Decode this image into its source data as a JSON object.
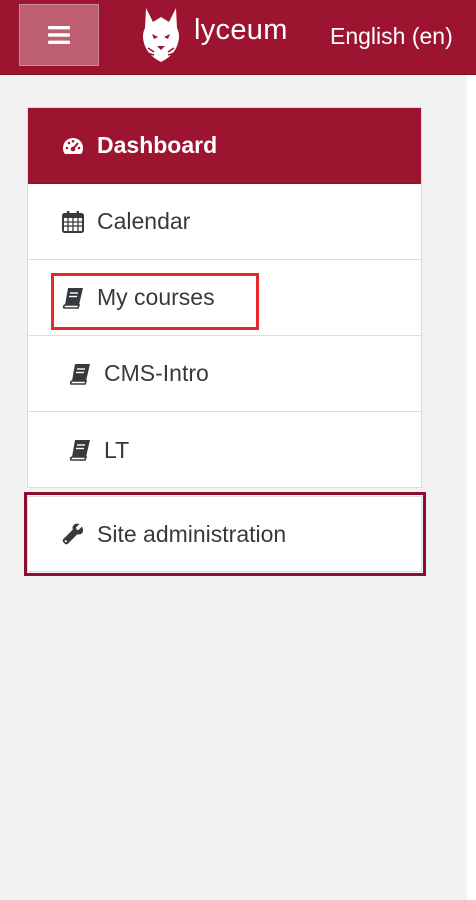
{
  "header": {
    "brand": "lyceum",
    "language": "English (en)",
    "colors": {
      "primary": "#9d1430",
      "menu_button": "#bd5f70"
    },
    "menu_icon": "hamburger-icon",
    "logo_icon": "lynx-logo-icon"
  },
  "nav": {
    "items": [
      {
        "label": "Dashboard",
        "icon": "dashboard-gauge-icon",
        "active": true
      },
      {
        "label": "Calendar",
        "icon": "calendar-icon",
        "active": false
      },
      {
        "label": "My courses",
        "icon": "book-icon",
        "active": false
      },
      {
        "label": "CMS-Intro",
        "icon": "book-icon",
        "active": false
      },
      {
        "label": "LT",
        "icon": "book-icon",
        "active": false
      }
    ],
    "admin": {
      "label": "Site administration",
      "icon": "wrench-icon"
    }
  },
  "annotations": {
    "highlight_colors": {
      "my_courses": "#e8262b",
      "site_admin": "#8b1030"
    }
  }
}
